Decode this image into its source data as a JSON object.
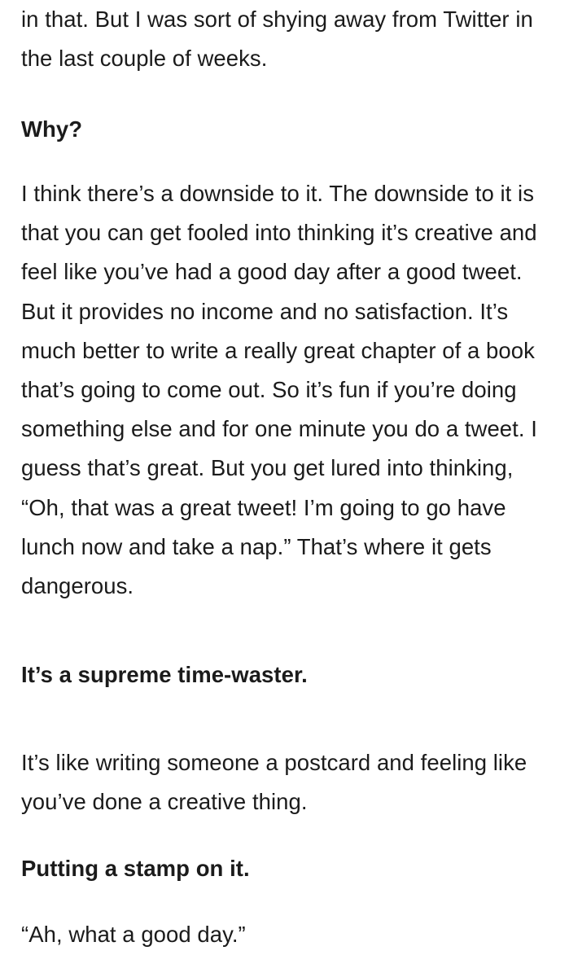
{
  "article": {
    "blocks": [
      {
        "type": "answer",
        "text": "in that. But I was sort of shying away from Twitter in the last couple of weeks."
      },
      {
        "type": "question",
        "text": "Why?"
      },
      {
        "type": "answer",
        "text": "I think there’s a downside to it. The downside to it is that you can get fooled into thinking it’s creative and feel like you’ve had a good day after a good tweet. But it provides no income and no satisfaction. It’s much better to write a really great chapter of a book that’s going to come out. So it’s fun if you’re doing something else and for one minute you do a tweet. I guess that’s great. But you get lured into thinking, “Oh, that was a great tweet! I’m going to go have lunch now and take a nap.” That’s where it gets dangerous."
      },
      {
        "type": "question",
        "text": "It’s a supreme time-waster."
      },
      {
        "type": "answer",
        "text": "It’s like writing someone a postcard and feeling like you’ve done a creative thing."
      },
      {
        "type": "question",
        "text": "Putting a stamp on it."
      },
      {
        "type": "answer",
        "text": "“Ah, what a good day.”"
      }
    ]
  }
}
